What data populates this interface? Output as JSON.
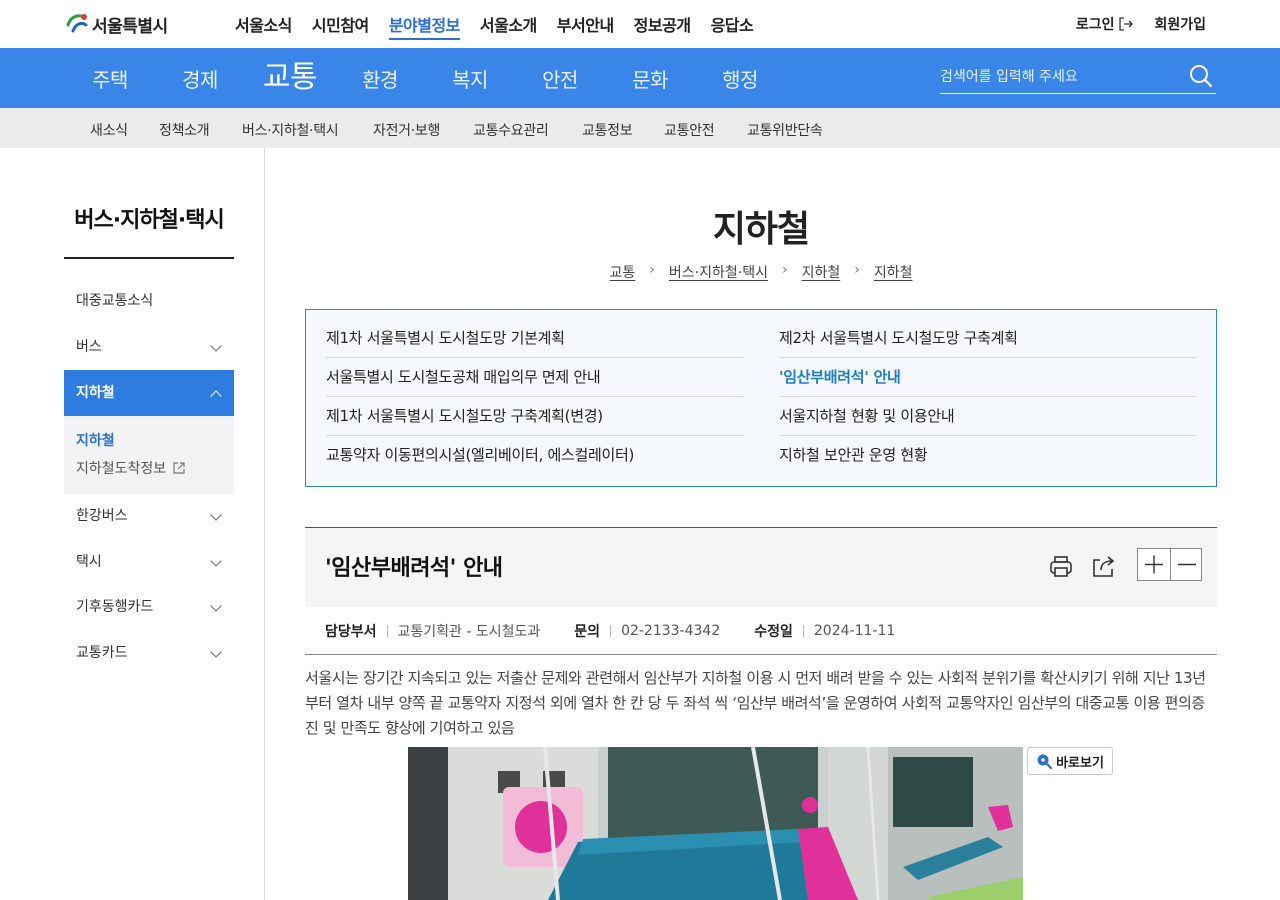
{
  "site": {
    "logo_text": "서울특별시"
  },
  "gnb": [
    "서울소식",
    "시민참여",
    "분야별정보",
    "서울소개",
    "부서안내",
    "정보공개",
    "응답소"
  ],
  "gnb_active": "분야별정보",
  "util": {
    "login": "로그인",
    "join": "회원가입"
  },
  "categories": [
    "주택",
    "경제",
    "교통",
    "환경",
    "복지",
    "안전",
    "문화",
    "행정"
  ],
  "category_active": "교통",
  "search": {
    "placeholder": "검색어를 입력해 주세요"
  },
  "subcategories": [
    "새소식",
    "정책소개",
    "버스·지하철·택시",
    "자전거·보행",
    "교통수요관리",
    "교통정보",
    "교통안전",
    "교통위반단속"
  ],
  "sidebar": {
    "title": "버스·지하철·택시",
    "items": [
      "대중교통소식",
      "버스",
      "지하철",
      "한강버스",
      "택시",
      "기후동행카드",
      "교통카드"
    ],
    "active": "지하철",
    "sub_items": [
      "지하철",
      "지하철도착정보"
    ]
  },
  "page": {
    "title": "지하철",
    "breadcrumb": [
      "교통",
      "버스·지하철·택시",
      "지하철",
      "지하철"
    ]
  },
  "links": {
    "left": [
      "제1차 서울특별시 도시철도망 기본계획",
      "서울특별시 도시철도공채 매입의무 면제 안내",
      "제1차 서울특별시 도시철도망 구축계획(변경)",
      "교통약자 이동편의시설(엘리베이터, 에스컬레이터)"
    ],
    "right": [
      "제2차 서울특별시 도시철도망 구축계획",
      "'임산부배려석' 안내",
      "서울지하철 현황 및 이용안내",
      "지하철 보안관 운영 현황"
    ],
    "current": "'임산부배려석' 안내"
  },
  "article": {
    "title": "'임산부배려석' 안내",
    "dept_label": "담당부서",
    "dept": "교통기획관 - 도시철도과",
    "contact_label": "문의",
    "contact": "02-2133-4342",
    "updated_label": "수정일",
    "updated": "2024-11-11",
    "body": "서울시는 장기간 지속되고 있는 저출산 문제와 관련해서 임산부가 지하철 이용 시 먼저 배려 받을 수 있는 사회적 분위기를 확산시키기 위해 지난 13년부터 열차 내부 양쪽 끝 교통약자 지정석 외에 열차 한 칸 당 두 좌석 씩 ‘임산부 배려석’을 운영하여 사회적 교통약자인 임산부의 대중교통 이용 편의증진 및 만족도 향상에 기여하고 있음",
    "view_button": "바로보기"
  },
  "colors": {
    "brand_blue": "#3a86e8",
    "active_link": "#1a7fc6",
    "seat_pink": "#e0309a",
    "seat_blue": "#1f7a9a"
  }
}
